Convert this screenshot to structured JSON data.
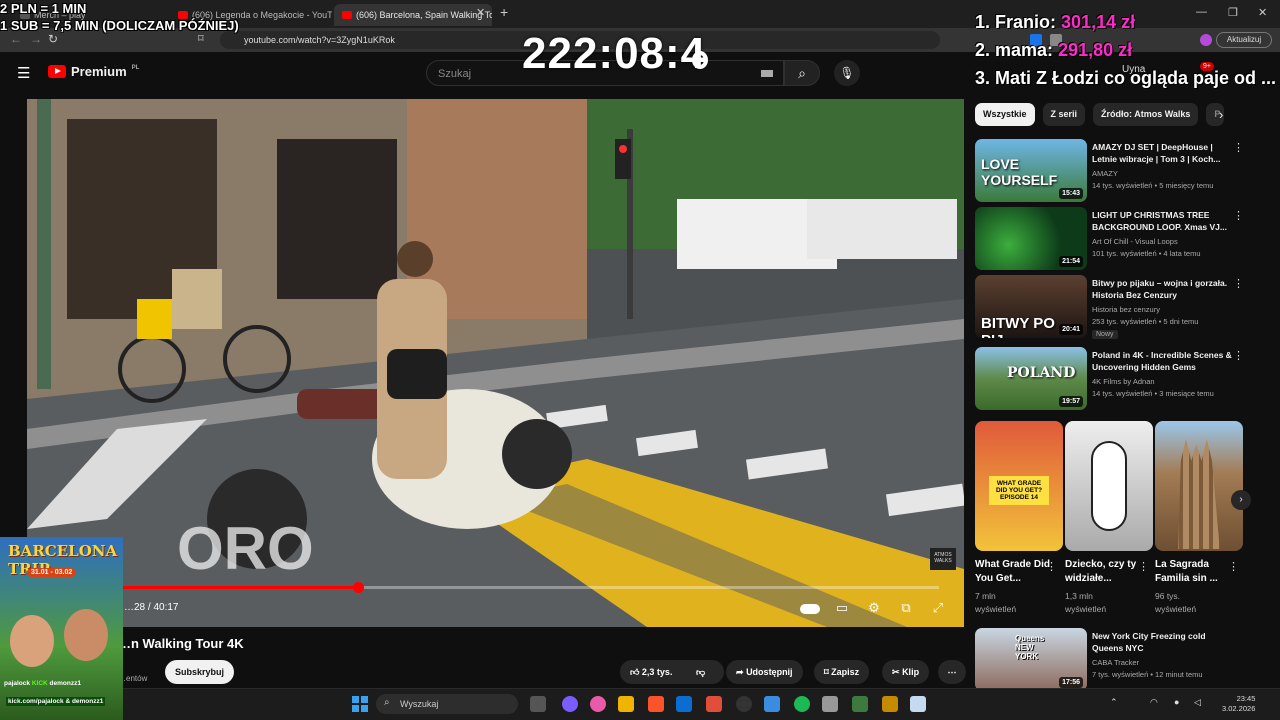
{
  "browser": {
    "tabs": [
      {
        "label": "Merch – play"
      },
      {
        "label": "(606) Legenda o Megakocie - YouTube"
      },
      {
        "label": "(606) Barcelona, Spain Walking Tour 4K"
      }
    ],
    "url": "youtube.com/watch?v=3ZygN1uKRok",
    "update_label": "Aktualizuj"
  },
  "youtube": {
    "logo_label": "Premium",
    "logo_region": "PL",
    "search_placeholder": "Szukaj",
    "notification_count": "9+",
    "user_label": "Uyna"
  },
  "player": {
    "progress_fraction": 0.31,
    "time_text": "…28 / 40:17",
    "watermark": "ATMOS WALKS"
  },
  "video": {
    "title": "…n Walking Tour 4K",
    "subscribe_label": "Subskrybuj",
    "subs_text": "…entów",
    "actions": {
      "like": "2,3 tys.",
      "share": "Udostępnij",
      "save": "Zapisz",
      "clip": "Klip"
    }
  },
  "chips": [
    "Wszystkie",
    "Z serii",
    "Źródło: Atmos Walks",
    "P"
  ],
  "recommendations": [
    {
      "title": "AMAZY DJ SET | DeepHouse | Letnie wibracje | Tom 3 | Koch...",
      "channel": "AMAZY",
      "meta": "14 tys. wyświetleń • 5 miesięcy temu",
      "duration": "15:43",
      "thumb_text": "LOVE YOURSELF",
      "thumb_color": "#4a8fbf"
    },
    {
      "title": "LIGHT UP CHRISTMAS TREE BACKGROUND LOOP. Xmas VJ...",
      "channel": "Art Of Chill - Visual Loops",
      "meta": "101 tys. wyświetleń • 4 lata temu",
      "duration": "21:54",
      "thumb_text": "",
      "thumb_color": "#0d3b1a"
    },
    {
      "title": "Bitwy po pijaku – wojna i gorzała. Historia Bez Cenzury",
      "channel": "Historia bez cenzury",
      "meta": "253 tys. wyświetleń • 5 dni temu",
      "duration": "20:41",
      "thumb_text": "BITWY PO PIJ...",
      "thumb_color": "#3a2a22",
      "badge": "Nowy"
    },
    {
      "title": "Poland in 4K - Incredible Scenes & Uncovering Hidden Gems",
      "channel": "4K Films by Adnan",
      "meta": "14 tys. wyświetleń • 3 miesiące temu",
      "duration": "19:57",
      "thumb_text": "POLAND",
      "thumb_color": "#5e8a4a"
    }
  ],
  "shorts": [
    {
      "title": "What Grade Did You Get...",
      "meta1": "7 mln",
      "meta2": "wyświetleń",
      "thumb_text": "WHAT GRADE DID YOU GET? EPISODE 14",
      "thumb_color": "#b8432b"
    },
    {
      "title": "Dziecko, czy ty widziałe...",
      "meta1": "1,3 mln",
      "meta2": "wyświetleń",
      "thumb_text": "",
      "thumb_color": "#c9c9c9"
    },
    {
      "title": "La Sagrada Familia sin ...",
      "meta1": "96 tys.",
      "meta2": "wyświetleń",
      "thumb_text": "",
      "thumb_color": "#a27c54"
    }
  ],
  "recommendation_bottom": {
    "title": "New York City Freezing cold Queens NYC",
    "channel": "CABA Tracker",
    "meta": "7 tys. wyświetleń • 12 minut temu",
    "duration": "17:56",
    "thumb_text": "Queens NEW YORK",
    "thumb_color": "#8c6a5c"
  },
  "taskbar": {
    "search_placeholder": "Wyszukaj",
    "time": "23:45",
    "date": "3.02.2026"
  },
  "stream_overlay": {
    "lines": [
      "2 PLN = 1 MIN",
      "1 SUB = 7,5 MIN (DOLICZAM PÓŹNIEJ)"
    ],
    "timer": "222:08:4",
    "leaderboard": [
      {
        "rank": "1. Franio:",
        "amount": "301,14 zł"
      },
      {
        "rank": "2. mama:",
        "amount": "291,80 zł"
      },
      {
        "rank": "3. Mati Z Łodzi co ogląda paje od ...",
        "amount": ""
      }
    ],
    "promo": {
      "title": "BARCELONA TRIP",
      "dates": "31.01 - 03.02",
      "handle1": "pajalock",
      "kick": "KICK",
      "handle2": "demonzz1",
      "link": "kick.com/pajalock & demonzz1"
    }
  },
  "colors": {
    "accent_red": "#ff0000",
    "overlay_pink": "#ff2cc9",
    "bg": "#0f0f0f"
  }
}
